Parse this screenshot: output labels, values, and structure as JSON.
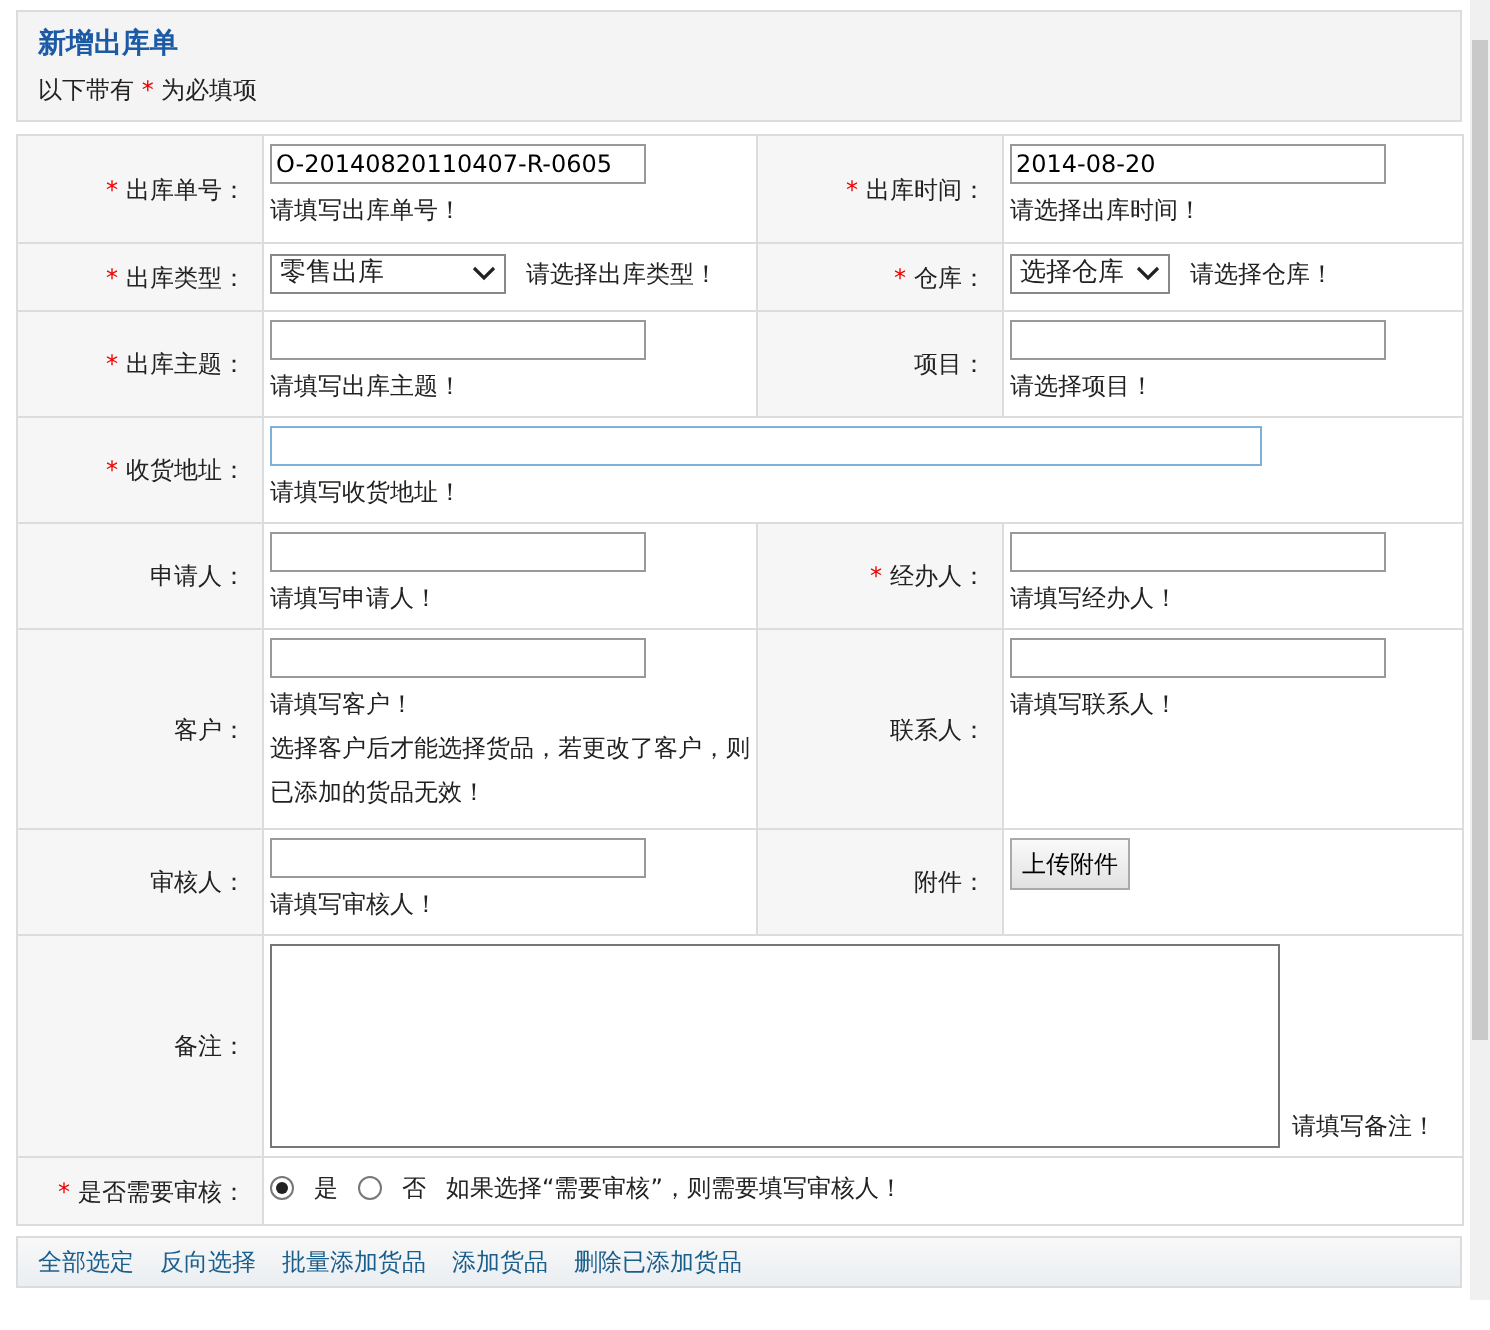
{
  "header": {
    "title": "新增出库单",
    "note": {
      "before": "以下带有",
      "mark": "*",
      "after": "为必填项"
    }
  },
  "rows": [
    {
      "cells": [
        {
          "label": {
            "mark": "*",
            "text": "出库单号："
          },
          "field": {
            "kind": "text",
            "value": "O-20140820110407-R-0605",
            "hint": "请填写出库单号！"
          }
        },
        {
          "label": {
            "mark": "*",
            "text": "出库时间："
          },
          "field": {
            "kind": "text",
            "value": "2014-08-20",
            "hint": "请选择出库时间！"
          }
        }
      ]
    },
    {
      "cells": [
        {
          "label": {
            "mark": "*",
            "text": "出库类型："
          },
          "field": {
            "kind": "select",
            "value": "零售出库",
            "hint": "请选择出库类型！"
          }
        },
        {
          "label": {
            "mark": "*",
            "text": "仓库："
          },
          "field": {
            "kind": "select",
            "value": "选择仓库",
            "hint": "请选择仓库！"
          }
        }
      ]
    },
    {
      "cells": [
        {
          "label": {
            "mark": "*",
            "text": "出库主题："
          },
          "field": {
            "kind": "text",
            "hint": "请填写出库主题！"
          }
        },
        {
          "label": {
            "text": "项目："
          },
          "field": {
            "kind": "text",
            "hint": "请选择项目！"
          }
        }
      ]
    },
    {
      "cells": [
        {
          "label": {
            "mark": "*",
            "text": "收货地址："
          },
          "field": {
            "kind": "wide_text",
            "focused": true,
            "hint": "请填写收货地址！"
          }
        }
      ]
    },
    {
      "cells": [
        {
          "label": {
            "text": "申请人："
          },
          "field": {
            "kind": "text",
            "hint": "请填写申请人！"
          }
        },
        {
          "label": {
            "mark": "*",
            "text": "经办人："
          },
          "field": {
            "kind": "text",
            "hint": "请填写经办人！"
          }
        }
      ]
    },
    {
      "cells": [
        {
          "label": {
            "text": "客户："
          },
          "field": {
            "kind": "text",
            "hint": "请填写客户！",
            "note": "选择客户后才能选择货品，若更改了客户，则已添加的货品无效！"
          }
        },
        {
          "label": {
            "text": "联系人："
          },
          "field": {
            "kind": "text",
            "hint": "请填写联系人！"
          }
        }
      ]
    },
    {
      "cells": [
        {
          "label": {
            "text": "审核人："
          },
          "field": {
            "kind": "text",
            "hint": "请填写审核人！"
          }
        },
        {
          "label": {
            "text": "附件："
          },
          "field": {
            "kind": "button",
            "value": "上传附件"
          }
        }
      ]
    },
    {
      "cells": [
        {
          "label": {
            "text": "备注："
          },
          "field": {
            "kind": "textarea",
            "hint": "请填写备注！"
          }
        }
      ]
    },
    {
      "cells": [
        {
          "label": {
            "mark": "*",
            "text": "是否需要审核："
          },
          "field": {
            "kind": "radio",
            "options": [
              {
                "label": "是",
                "selected": true
              },
              {
                "label": "否",
                "selected": false
              }
            ],
            "hint": "如果选择“需要审核”，则需要填写审核人！"
          }
        }
      ]
    }
  ],
  "links": [
    "全部选定",
    "反向选择",
    "批量添加货品",
    "添加货品",
    "删除已添加货品"
  ]
}
